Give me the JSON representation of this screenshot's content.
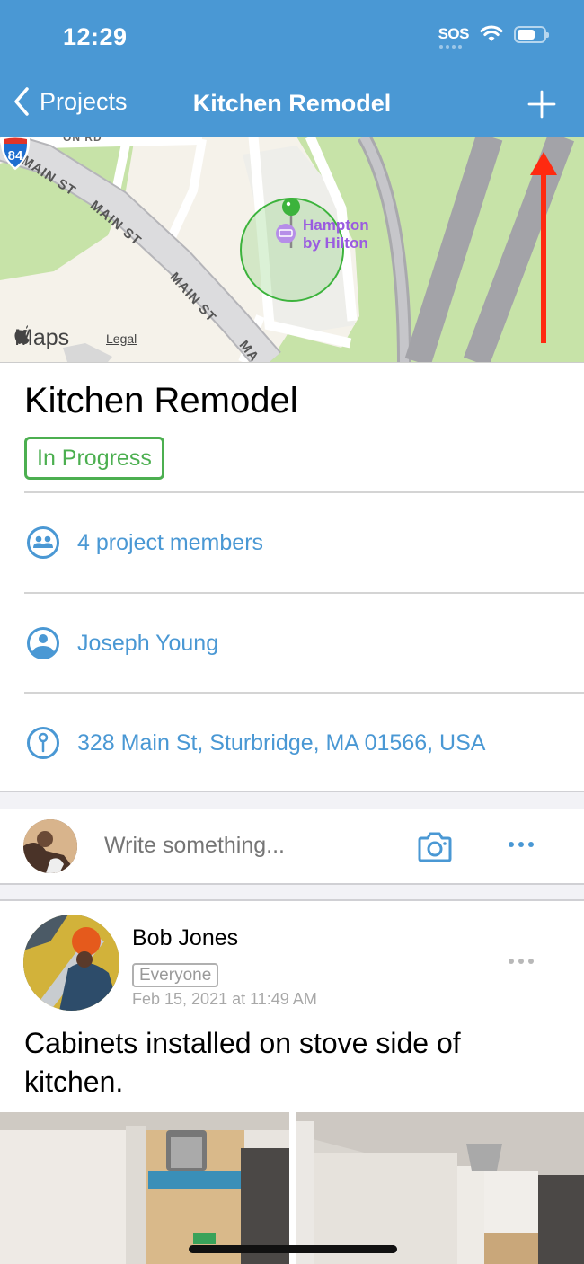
{
  "status_bar": {
    "time": "12:29",
    "carrier": "SOS"
  },
  "nav": {
    "back_label": "Projects",
    "title": "Kitchen Remodel",
    "add_icon": "plus-icon"
  },
  "map": {
    "street_labels": [
      "MAIN ST",
      "MAIN ST",
      "MAIN ST",
      "MAIN ST",
      "MA",
      "ON RD"
    ],
    "poi_name_line1": "Hampton",
    "poi_name_line2": "by Hilton",
    "highway_shield": "84",
    "maps_brand": "Maps",
    "legal_link": "Legal",
    "annotation": "red-arrow-pointing-to-add-button"
  },
  "project": {
    "title": "Kitchen Remodel",
    "status": "In Progress",
    "status_color": "#4caf50",
    "accent_color": "#4a98d4",
    "rows": [
      {
        "icon": "people-icon",
        "label": "4 project members"
      },
      {
        "icon": "person-icon",
        "label": "Joseph Young"
      },
      {
        "icon": "location-pin-icon",
        "label": "328 Main St, Sturbridge, MA 01566, USA"
      }
    ]
  },
  "composer": {
    "placeholder": "Write something...",
    "camera_icon": "camera-icon",
    "more_icon": "more-icon"
  },
  "post": {
    "author": "Bob Jones",
    "audience": "Everyone",
    "timestamp": "Feb 15, 2021 at 11:49 AM",
    "body": "Cabinets installed on stove side of kitchen.",
    "photos": [
      "cabinet-photo-1",
      "cabinet-photo-2"
    ]
  }
}
